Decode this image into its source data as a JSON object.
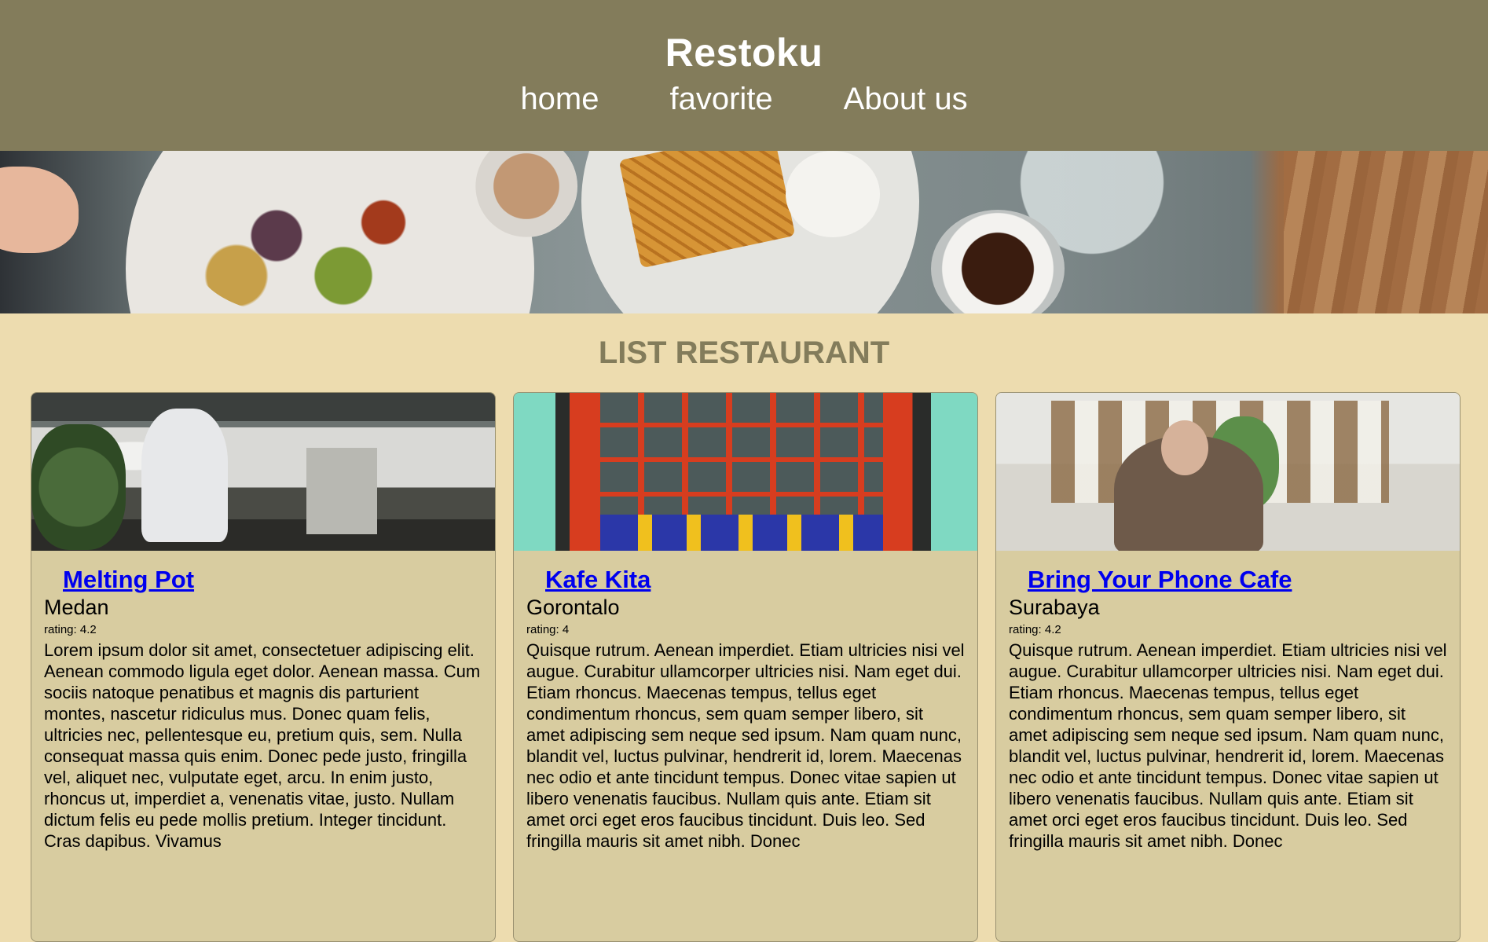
{
  "header": {
    "brand": "Restoku",
    "nav": [
      "home",
      "favorite",
      "About us"
    ]
  },
  "main": {
    "section_title": "LIST RESTAURANT",
    "restaurants": [
      {
        "name": "Melting Pot",
        "city": "Medan",
        "rating": "rating: 4.2",
        "description": "Lorem ipsum dolor sit amet, consectetuer adipiscing elit. Aenean commodo ligula eget dolor. Aenean massa. Cum sociis natoque penatibus et magnis dis parturient montes, nascetur ridiculus mus. Donec quam felis, ultricies nec, pellentesque eu, pretium quis, sem. Nulla consequat massa quis enim. Donec pede justo, fringilla vel, aliquet nec, vulputate eget, arcu. In enim justo, rhoncus ut, imperdiet a, venenatis vitae, justo. Nullam dictum felis eu pede mollis pretium. Integer tincidunt. Cras dapibus. Vivamus"
      },
      {
        "name": "Kafe Kita",
        "city": "Gorontalo",
        "rating": "rating: 4",
        "description": "Quisque rutrum. Aenean imperdiet. Etiam ultricies nisi vel augue. Curabitur ullamcorper ultricies nisi. Nam eget dui. Etiam rhoncus. Maecenas tempus, tellus eget condimentum rhoncus, sem quam semper libero, sit amet adipiscing sem neque sed ipsum. Nam quam nunc, blandit vel, luctus pulvinar, hendrerit id, lorem. Maecenas nec odio et ante tincidunt tempus. Donec vitae sapien ut libero venenatis faucibus. Nullam quis ante. Etiam sit amet orci eget eros faucibus tincidunt. Duis leo. Sed fringilla mauris sit amet nibh. Donec"
      },
      {
        "name": "Bring Your Phone Cafe",
        "city": "Surabaya",
        "rating": "rating: 4.2",
        "description": "Quisque rutrum. Aenean imperdiet. Etiam ultricies nisi vel augue. Curabitur ullamcorper ultricies nisi. Nam eget dui. Etiam rhoncus. Maecenas tempus, tellus eget condimentum rhoncus, sem quam semper libero, sit amet adipiscing sem neque sed ipsum. Nam quam nunc, blandit vel, luctus pulvinar, hendrerit id, lorem. Maecenas nec odio et ante tincidunt tempus. Donec vitae sapien ut libero venenatis faucibus. Nullam quis ante. Etiam sit amet orci eget eros faucibus tincidunt. Duis leo. Sed fringilla mauris sit amet nibh. Donec"
      }
    ]
  },
  "colors": {
    "header_bg": "#837c5b",
    "page_bg": "#eddcaf",
    "card_bg": "#d8cca0",
    "link": "#0000ee"
  }
}
